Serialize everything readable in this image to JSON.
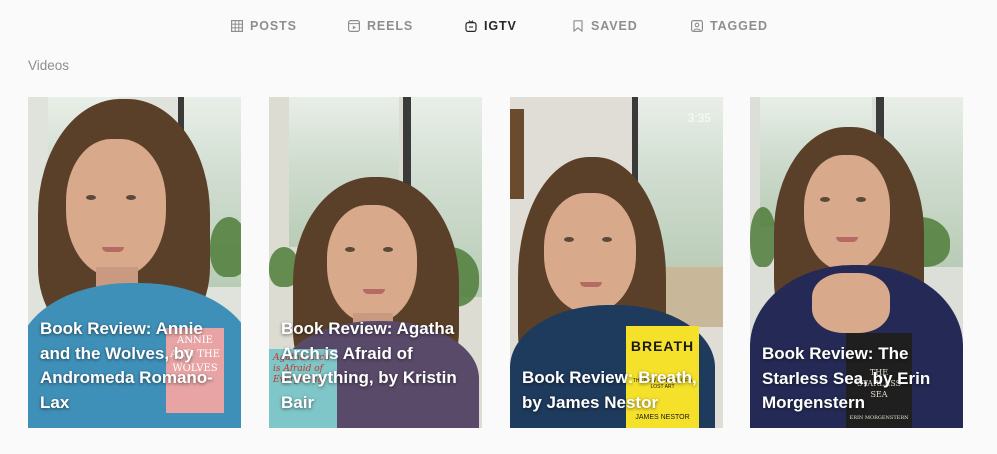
{
  "tabs": [
    {
      "label": "POSTS",
      "icon": "grid-icon",
      "active": false
    },
    {
      "label": "REELS",
      "icon": "reels-icon",
      "active": false
    },
    {
      "label": "IGTV",
      "icon": "igtv-icon",
      "active": true
    },
    {
      "label": "SAVED",
      "icon": "bookmark-icon",
      "active": false
    },
    {
      "label": "TAGGED",
      "icon": "tagged-icon",
      "active": false
    }
  ],
  "section_title": "Videos",
  "videos": [
    {
      "title": "Book Review: Annie and the Wolves, by Andromeda Romano-Lax",
      "duration": "",
      "book_cover_text": "ANNIE AND THE WOLVES",
      "book_color": "#e8a4a4"
    },
    {
      "title": "Book Review: Agatha Arch is Afraid of Everything, by Kristin Bair",
      "duration": "",
      "book_cover_text": "Agatha Arch is Afraid of Everything",
      "book_color": "#7fc6c9"
    },
    {
      "title": "Book Review: Breath, by James Nestor",
      "duration": "3:35",
      "book_cover_text": "BREATH",
      "book_subtext": "THE NEW SCIENCE OF A LOST ART",
      "book_author": "JAMES NESTOR",
      "book_color": "#f5e12a"
    },
    {
      "title": "Book Review: The Starless Sea, by Erin Morgenstern",
      "duration": "",
      "book_cover_text": "THE STARLESS SEA",
      "book_author": "ERIN MORGENSTERN",
      "book_color": "#1f1f1f"
    }
  ],
  "colors": {
    "background": "#fafafa",
    "tab_inactive": "#8e8e8e",
    "tab_active": "#262626"
  }
}
